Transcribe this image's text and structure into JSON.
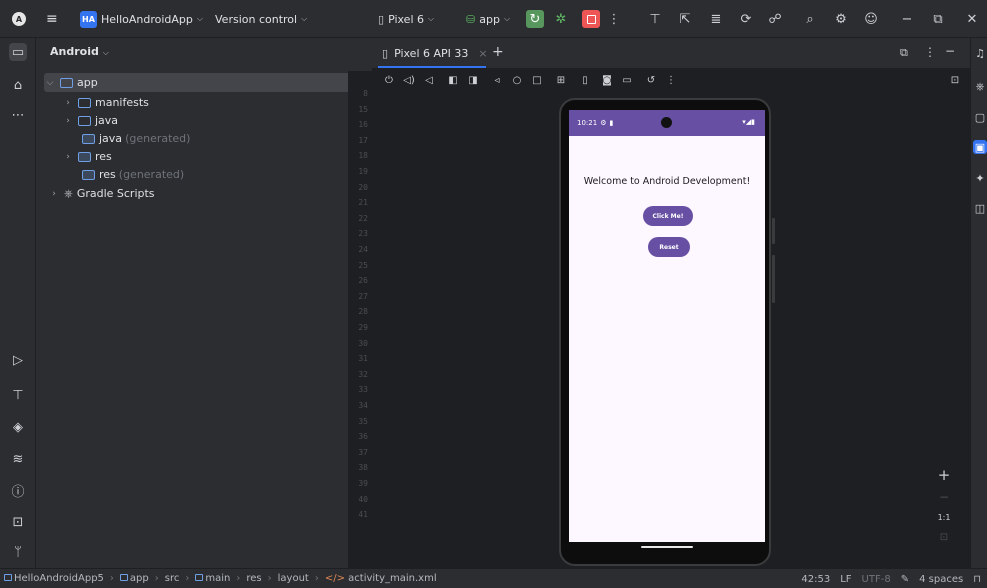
{
  "titlebar": {
    "project_badge": "HA",
    "project_name": "HelloAndroidApp",
    "version_control": "Version control",
    "device": "Pixel 6",
    "run_config": "app"
  },
  "project_panel": {
    "header": "Android",
    "tree": [
      {
        "label": "app",
        "suffix": ""
      },
      {
        "label": "manifests",
        "suffix": ""
      },
      {
        "label": "java",
        "suffix": ""
      },
      {
        "label": "java",
        "suffix": " (generated)"
      },
      {
        "label": "res",
        "suffix": ""
      },
      {
        "label": "res",
        "suffix": " (generated)"
      },
      {
        "label": "Gradle Scripts",
        "suffix": ""
      }
    ]
  },
  "gutter": {
    "lines": [
      "8",
      "15",
      "16",
      "17",
      "18",
      "19",
      "20",
      "21",
      "22",
      "23",
      "24",
      "25",
      "26",
      "27",
      "28",
      "29",
      "30",
      "31",
      "32",
      "33",
      "34",
      "35",
      "36",
      "37",
      "38",
      "39",
      "40",
      "41"
    ]
  },
  "device_panel": {
    "tab_label": "Pixel 6 API 33",
    "phone": {
      "time": "10:21",
      "welcome_text": "Welcome to Android Development!",
      "click_button": "Click Me!",
      "reset_button": "Reset"
    },
    "zoom": {
      "plus": "+",
      "minus": "−",
      "one_to_one": "1:1"
    }
  },
  "statusbar": {
    "breadcrumb": [
      "HelloAndroidApp5",
      "app",
      "src",
      "main",
      "res",
      "layout",
      "activity_main.xml"
    ],
    "position": "42:53",
    "line_ending": "LF",
    "encoding": "UTF-8",
    "indent": "4 spaces"
  },
  "colors": {
    "accent": "#3574f0",
    "phone_primary": "#6750a4",
    "run_green": "#57965c",
    "stop_red": "#e55555"
  }
}
